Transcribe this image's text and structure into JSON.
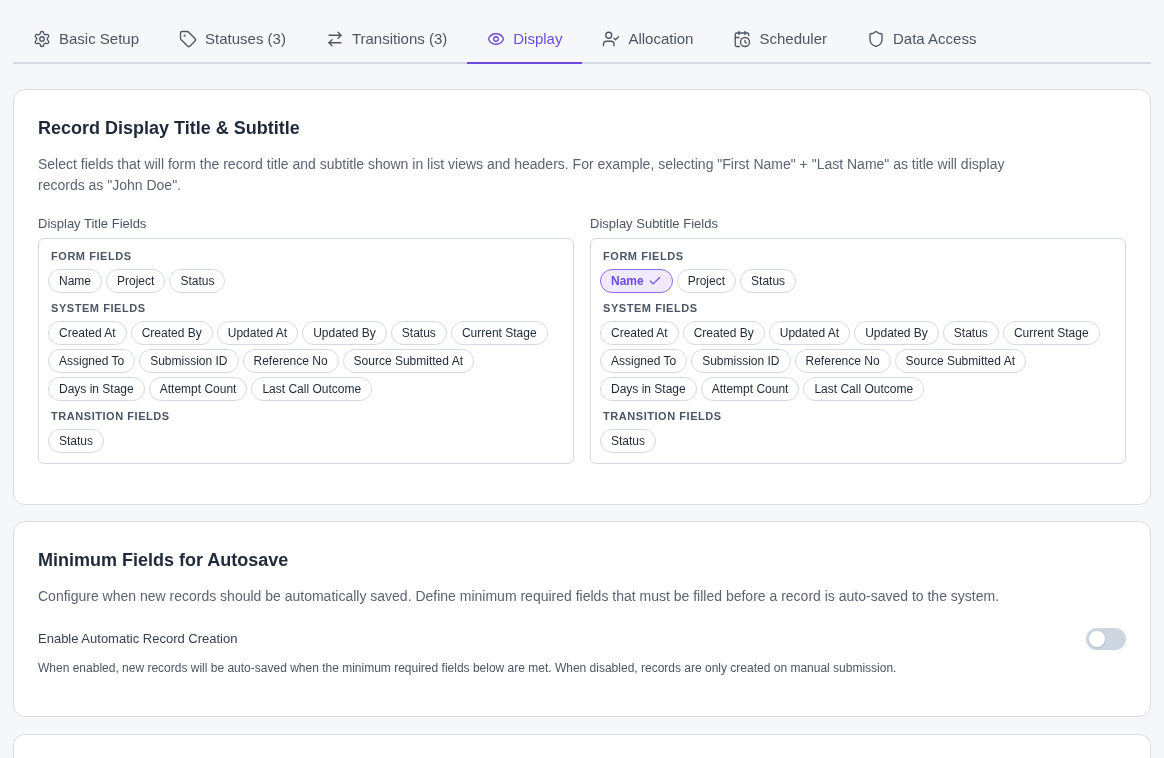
{
  "tabs": [
    {
      "label": "Basic Setup",
      "selected": false
    },
    {
      "label": "Statuses (3)",
      "selected": false
    },
    {
      "label": "Transitions (3)",
      "selected": false
    },
    {
      "label": "Display",
      "selected": true
    },
    {
      "label": "Allocation",
      "selected": false
    },
    {
      "label": "Scheduler",
      "selected": false
    },
    {
      "label": "Data Access",
      "selected": false
    }
  ],
  "record_display": {
    "title": "Record Display Title & Subtitle",
    "description": "Select fields that will form the record title and subtitle shown in list views and headers. For example, selecting \"First Name\" + \"Last Name\" as title will display records as \"John Doe\".",
    "pickers": [
      {
        "label": "Display Title Fields",
        "groups": [
          {
            "heading": "FORM FIELDS",
            "chips": [
              {
                "label": "Name",
                "selected": false
              },
              {
                "label": "Project",
                "selected": false
              },
              {
                "label": "Status",
                "selected": false
              }
            ]
          },
          {
            "heading": "SYSTEM FIELDS",
            "chips": [
              {
                "label": "Created At",
                "selected": false
              },
              {
                "label": "Created By",
                "selected": false
              },
              {
                "label": "Updated At",
                "selected": false
              },
              {
                "label": "Updated By",
                "selected": false
              },
              {
                "label": "Status",
                "selected": false
              },
              {
                "label": "Current Stage",
                "selected": false
              },
              {
                "label": "Assigned To",
                "selected": false
              },
              {
                "label": "Submission ID",
                "selected": false
              },
              {
                "label": "Reference No",
                "selected": false
              },
              {
                "label": "Source Submitted At",
                "selected": false
              },
              {
                "label": "Days in Stage",
                "selected": false
              },
              {
                "label": "Attempt Count",
                "selected": false
              },
              {
                "label": "Last Call Outcome",
                "selected": false
              }
            ]
          },
          {
            "heading": "TRANSITION FIELDS",
            "chips": [
              {
                "label": "Status",
                "selected": false
              }
            ]
          }
        ]
      },
      {
        "label": "Display Subtitle Fields",
        "groups": [
          {
            "heading": "FORM FIELDS",
            "chips": [
              {
                "label": "Name",
                "selected": true
              },
              {
                "label": "Project",
                "selected": false
              },
              {
                "label": "Status",
                "selected": false
              }
            ]
          },
          {
            "heading": "SYSTEM FIELDS",
            "chips": [
              {
                "label": "Created At",
                "selected": false
              },
              {
                "label": "Created By",
                "selected": false
              },
              {
                "label": "Updated At",
                "selected": false
              },
              {
                "label": "Updated By",
                "selected": false
              },
              {
                "label": "Status",
                "selected": false
              },
              {
                "label": "Current Stage",
                "selected": false
              },
              {
                "label": "Assigned To",
                "selected": false
              },
              {
                "label": "Submission ID",
                "selected": false
              },
              {
                "label": "Reference No",
                "selected": false
              },
              {
                "label": "Source Submitted At",
                "selected": false
              },
              {
                "label": "Days in Stage",
                "selected": false
              },
              {
                "label": "Attempt Count",
                "selected": false
              },
              {
                "label": "Last Call Outcome",
                "selected": false
              }
            ]
          },
          {
            "heading": "TRANSITION FIELDS",
            "chips": [
              {
                "label": "Status",
                "selected": false
              }
            ]
          }
        ]
      }
    ]
  },
  "autosave": {
    "title": "Minimum Fields for Autosave",
    "description": "Configure when new records should be automatically saved. Define minimum required fields that must be filled before a record is auto-saved to the system.",
    "toggle": {
      "label": "Enable Automatic Record Creation",
      "on": false,
      "help": "When enabled, new records will be auto-saved when the minimum required fields below are met. When disabled, records are only created on manual submission."
    }
  }
}
